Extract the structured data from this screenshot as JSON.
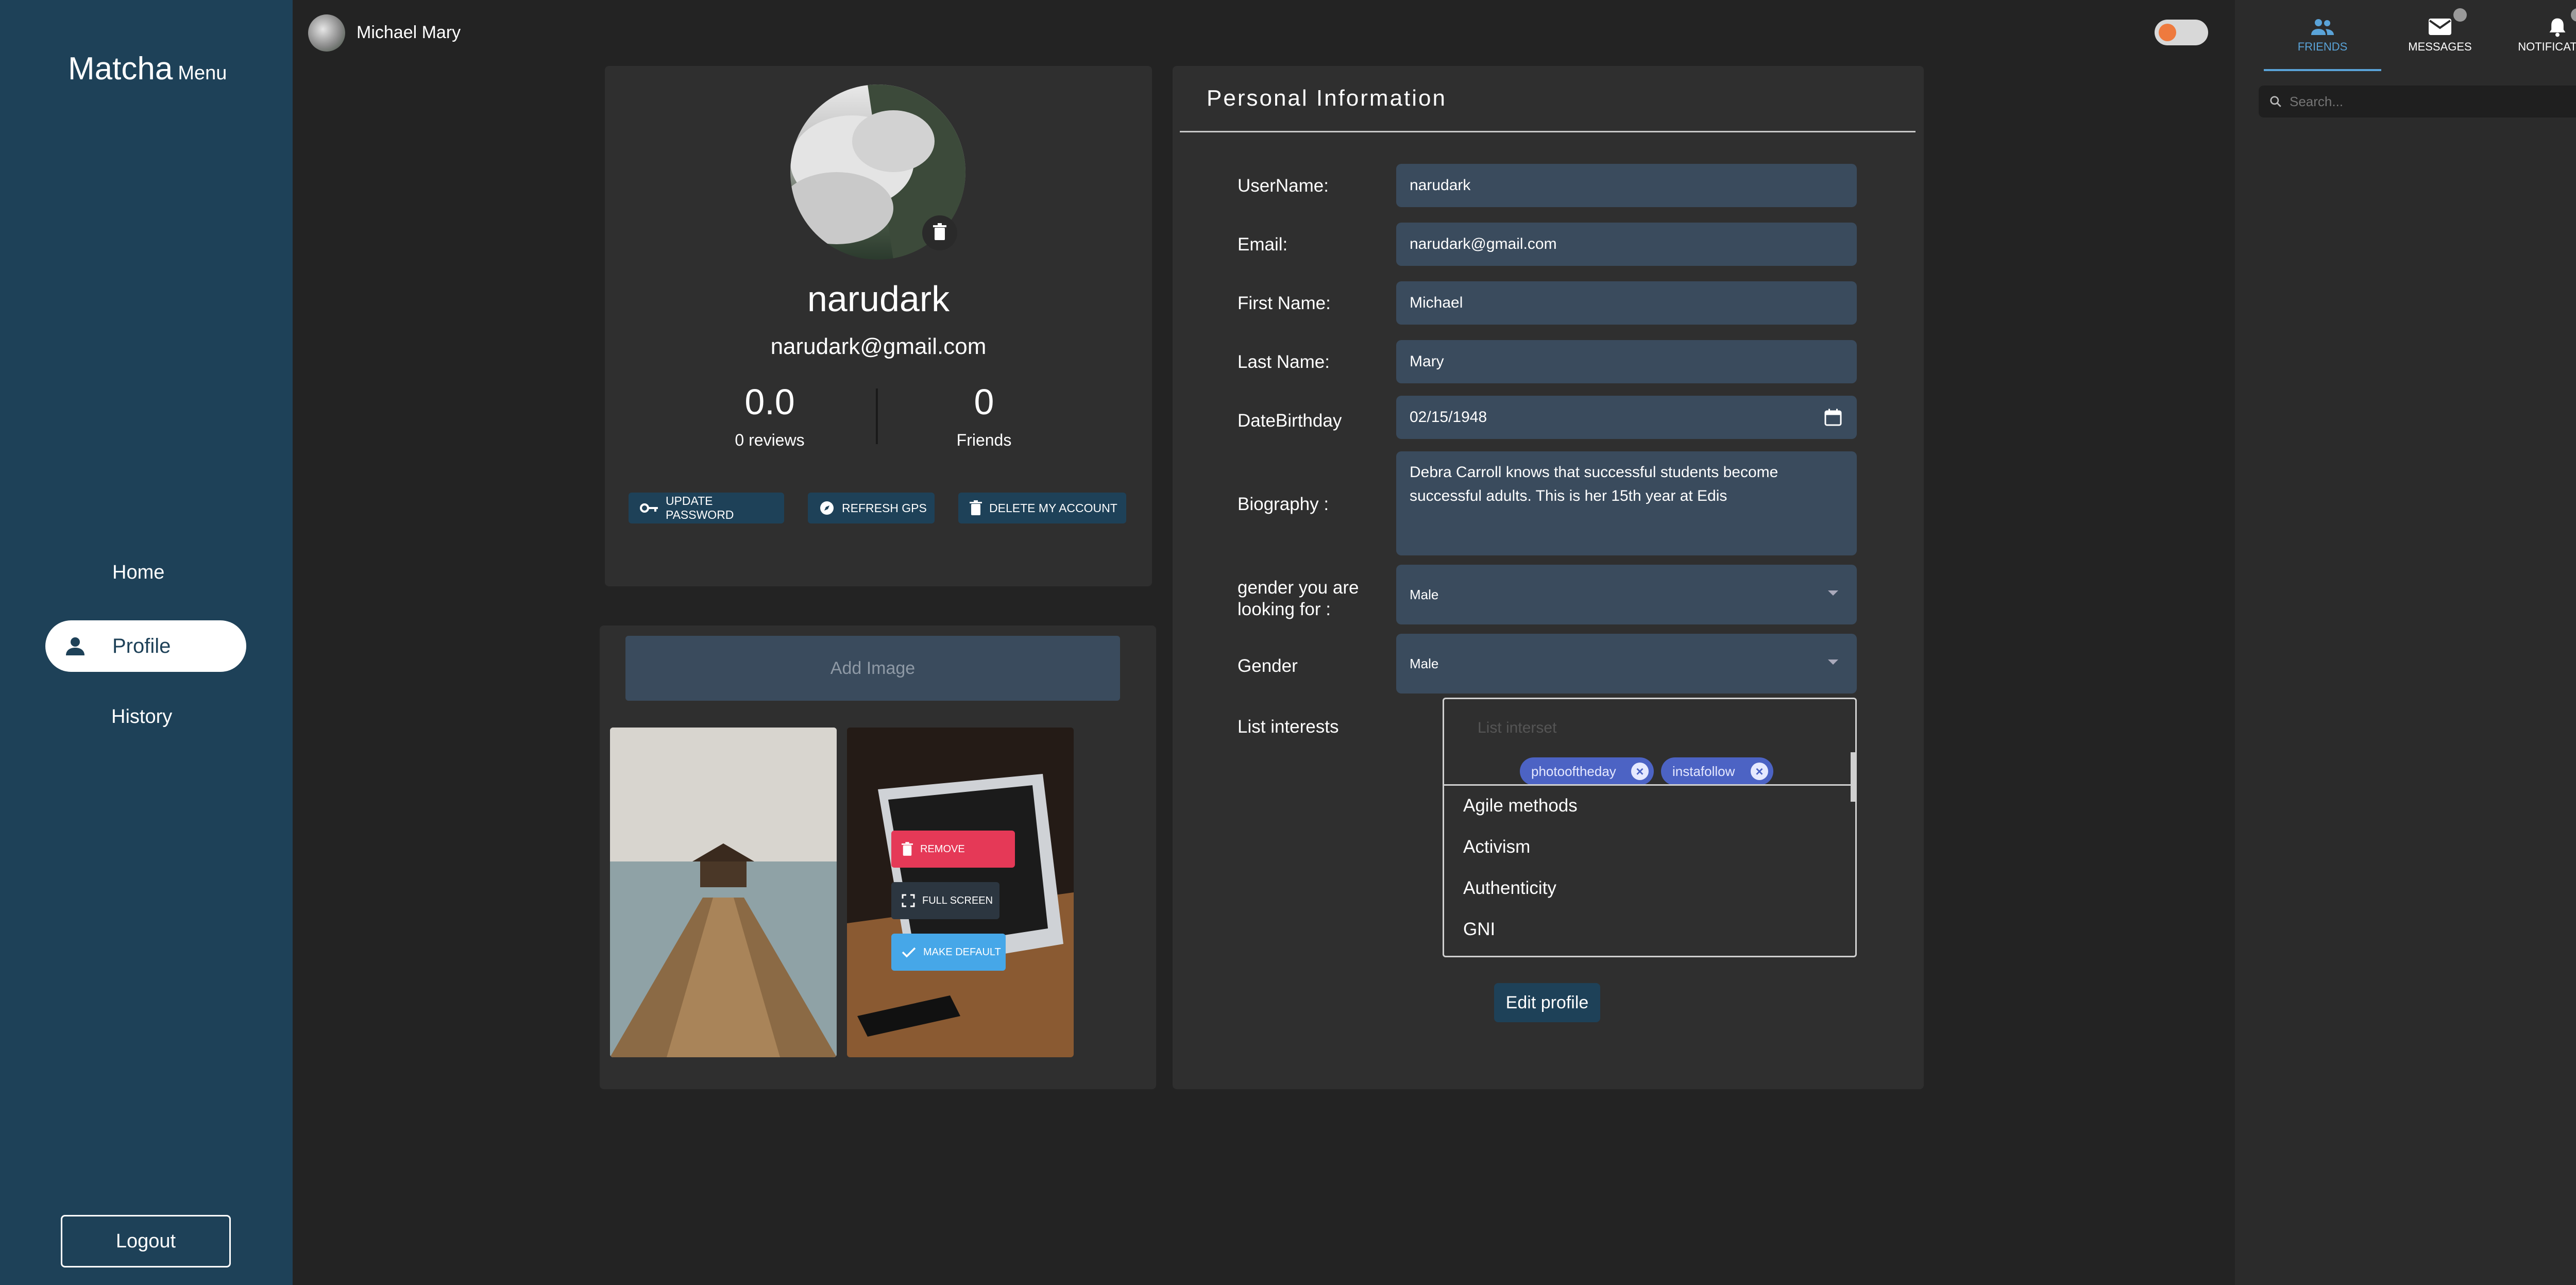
{
  "app": {
    "logo": "Matcha",
    "logo_menu": "Menu"
  },
  "sidebar": {
    "items": [
      {
        "label": "Home",
        "active": false
      },
      {
        "label": "Profile",
        "active": true
      },
      {
        "label": "History",
        "active": false
      }
    ],
    "logout_label": "Logout"
  },
  "topbar": {
    "user_name": "Michael Mary",
    "theme_toggle": "on"
  },
  "right_panel": {
    "tabs": [
      {
        "label": "FRIENDS",
        "icon": "people-icon",
        "active": true
      },
      {
        "label": "MESSAGES",
        "icon": "envelope-icon",
        "badge": true
      },
      {
        "label": "NOTIFICATION",
        "icon": "bell-icon",
        "badge": true
      }
    ],
    "search_placeholder": "Search..."
  },
  "profile": {
    "username": "narudark",
    "email": "narudark@gmail.com",
    "rating": "0.0",
    "reviews_label": "0 reviews",
    "friends_count": "0",
    "friends_label": "Friends",
    "buttons": {
      "update_password": "UPDATE PASSWORD",
      "refresh_gps": "REFRESH GPS",
      "delete_account": "DELETE MY ACCOUNT"
    }
  },
  "images": {
    "add_label": "Add Image",
    "overlay": {
      "remove": "REMOVE",
      "full_screen": "FULL SCREEN",
      "make_default": "MAKE DEFAULT"
    }
  },
  "personal_info": {
    "title": "Personal Information",
    "labels": {
      "username": "UserName:",
      "email": "Email:",
      "first_name": "First Name:",
      "last_name": "Last Name:",
      "birthday": "DateBirthday",
      "biography": "Biography :",
      "looking_for": "gender you are looking for :",
      "gender": "Gender",
      "interests": "List interests"
    },
    "values": {
      "username": "narudark",
      "email": "narudark@gmail.com",
      "first_name": "Michael",
      "last_name": "Mary",
      "birthday": "02/15/1948",
      "biography": "Debra Carroll knows that successful students become successful adults. This is her 15th year at Edis",
      "looking_for": "Male",
      "gender": "Male"
    },
    "interests": {
      "placeholder": "List interset",
      "chips": [
        "photooftheday",
        "instafollow"
      ],
      "options": [
        "Agile methods",
        "Activism",
        "Authenticity",
        "GNI"
      ]
    },
    "edit_label": "Edit profile"
  },
  "colors": {
    "sidebar": "#1e4158",
    "background": "#232323",
    "card": "#2f2f2f",
    "field": "#3a4b5d",
    "accent_blue": "#5aa3d8",
    "remove_red": "#e53957",
    "chip": "#4c63c4"
  }
}
